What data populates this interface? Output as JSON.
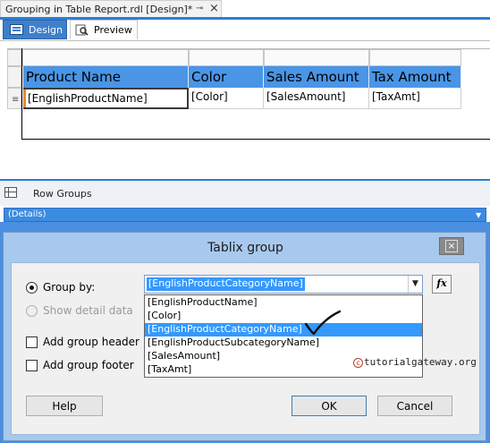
{
  "document_tab": {
    "title": "Grouping in Table Report.rdl [Design]*",
    "pin_glyph": "⊸",
    "close_glyph": "×"
  },
  "mode_tabs": [
    {
      "label": "Design",
      "active": true,
      "icon": "design-icon"
    },
    {
      "label": "Preview",
      "active": false,
      "icon": "preview-icon"
    }
  ],
  "tablix": {
    "headers": [
      "Product Name",
      "Color",
      "Sales Amount",
      "Tax Amount"
    ],
    "detail_cells": [
      "[EnglishProductName]",
      "[Color]",
      "[SalesAmount]",
      "[TaxAmt]"
    ],
    "detail_row_handle_glyph": "≡"
  },
  "grouping_pane": {
    "row_groups_label": "Row Groups",
    "details_group": "(Details)",
    "dropdown_glyph": "▼"
  },
  "dialog": {
    "title": "Tablix group",
    "close_glyph": "×",
    "group_by_label": "Group by:",
    "group_by_checked": true,
    "show_detail_label": "Show detail data",
    "show_detail_enabled": false,
    "group_by_value": "[EnglishProductCategoryName]",
    "combo_dropdown_glyph": "▼",
    "fx_label": "fx",
    "options": [
      "[EnglishProductName]",
      "[Color]",
      "[EnglishProductCategoryName]",
      "[EnglishProductSubcategoryName]",
      "[SalesAmount]",
      "[TaxAmt]"
    ],
    "selected_option_index": 2,
    "add_header_label": "Add group header",
    "add_footer_label": "Add group footer",
    "help_label": "Help",
    "ok_label": "OK",
    "cancel_label": "Cancel"
  },
  "watermark": {
    "c_glyph": "c",
    "text": "tutorialgateway.org"
  },
  "colors": {
    "accent_blue": "#2a7fd4",
    "header_blue": "#4a95e6",
    "selection": "#3399ff"
  }
}
